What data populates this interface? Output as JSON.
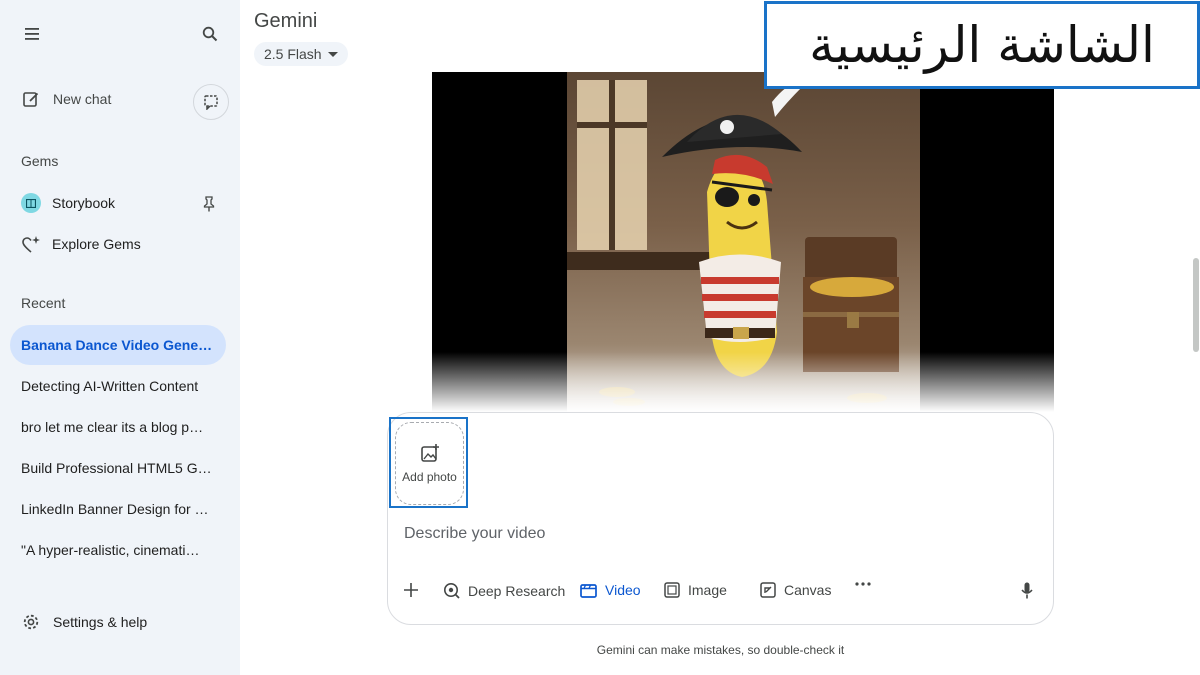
{
  "annotation_label": "الشاشة الرئيسية",
  "sidebar": {
    "new_chat_label": "New chat",
    "gems_heading": "Gems",
    "gems": [
      {
        "label": "Storybook",
        "icon": "book-icon"
      },
      {
        "label": "Explore Gems",
        "icon": "gem-sparkle-icon"
      }
    ],
    "recent_heading": "Recent",
    "recent": [
      {
        "label": "Banana Dance Video Gene…",
        "active": true
      },
      {
        "label": "Detecting AI-Written Content",
        "active": false
      },
      {
        "label": "bro let me clear its a blog p…",
        "active": false
      },
      {
        "label": "Build Professional HTML5 G…",
        "active": false
      },
      {
        "label": "LinkedIn Banner Design for …",
        "active": false
      },
      {
        "label": "\"A hyper-realistic, cinemati…",
        "active": false
      }
    ],
    "settings_label": "Settings & help"
  },
  "header": {
    "title": "Gemini",
    "model_label": "2.5 Flash"
  },
  "composer": {
    "add_photo_label": "Add photo",
    "placeholder": "Describe your video",
    "tools": [
      {
        "label": "Deep Research",
        "icon": "deep-research-icon",
        "selected": false
      },
      {
        "label": "Video",
        "icon": "video-icon",
        "selected": true
      },
      {
        "label": "Image",
        "icon": "image-icon",
        "selected": false
      },
      {
        "label": "Canvas",
        "icon": "canvas-icon",
        "selected": false
      }
    ]
  },
  "footer": {
    "disclaimer": "Gemini can make mistakes, so double-check it"
  },
  "colors": {
    "accent": "#0b57d0",
    "sidebar_bg": "#f0f4f9",
    "active_item_bg": "#d3e3fd",
    "annotation_border": "#1a73c8"
  }
}
